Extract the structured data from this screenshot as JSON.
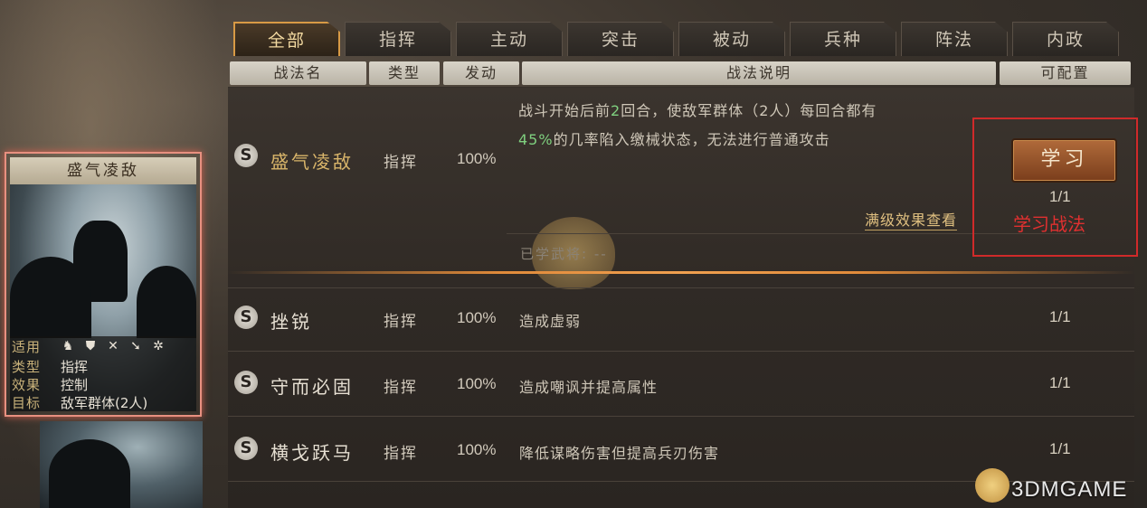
{
  "tabs": [
    "全部",
    "指挥",
    "主动",
    "突击",
    "被动",
    "兵种",
    "阵法",
    "内政"
  ],
  "headers": {
    "name": "战法名",
    "type": "类型",
    "trigger": "发动",
    "desc": "战法说明",
    "config": "可配置"
  },
  "selected": {
    "grade": "S",
    "name": "盛气凌敌",
    "type": "指挥",
    "rate": "100%",
    "desc_line1_pre": "战斗开始后前",
    "desc_line1_hl": "2",
    "desc_line1_post": "回合，使敌军群体（2人）每回合都有",
    "desc_line2_hl": "45%",
    "desc_line2_post": "的几率陷入缴械状态，无法进行普通攻击",
    "learn_button": "学习",
    "config": "1/1",
    "max_effect_link": "满级效果查看",
    "learned_label": "已学武将:",
    "learned_value": "--",
    "annotation": "学习战法"
  },
  "rows": [
    {
      "grade": "S",
      "name": "挫锐",
      "type": "指挥",
      "rate": "100%",
      "desc": "造成虚弱",
      "config": "1/1"
    },
    {
      "grade": "S",
      "name": "守而必固",
      "type": "指挥",
      "rate": "100%",
      "desc": "造成嘲讽并提高属性",
      "config": "1/1"
    },
    {
      "grade": "S",
      "name": "横戈跃马",
      "type": "指挥",
      "rate": "100%",
      "desc": "降低谋略伤害但提高兵刃伤害",
      "config": "1/1"
    }
  ],
  "card": {
    "title": "盛气凌敌",
    "labels": {
      "suit": "适用",
      "type": "类型",
      "effect": "效果",
      "target": "目标"
    },
    "type": "指挥",
    "effect": "控制",
    "target": "敌军群体(2人)",
    "unit_icons": [
      "cavalry-icon",
      "shield-icon",
      "crossed-bows-icon",
      "spear-icon",
      "wheel-icon"
    ]
  },
  "watermark": "3DMGAME"
}
